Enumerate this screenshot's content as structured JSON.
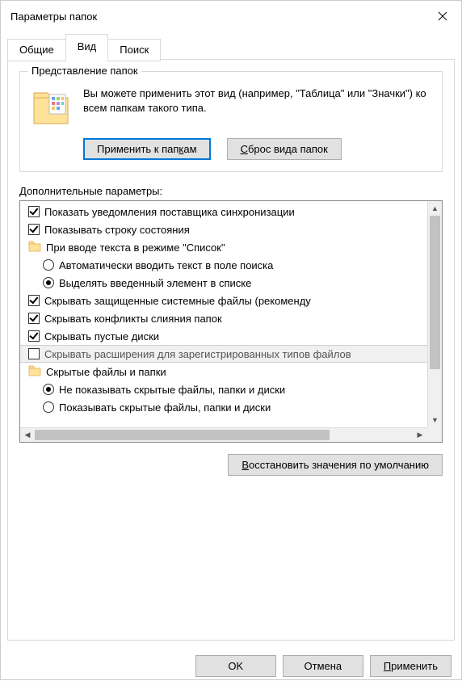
{
  "window": {
    "title": "Параметры папок"
  },
  "tabs": {
    "general": "Общие",
    "view": "Вид",
    "search": "Поиск"
  },
  "folderViews": {
    "legend": "Представление папок",
    "description": "Вы можете применить этот вид (например, \"Таблица\" или \"Значки\") ко всем папкам такого типа.",
    "applyBtn_pre": "Применить к пап",
    "applyBtn_u": "к",
    "applyBtn_post": "ам",
    "resetBtn_u": "С",
    "resetBtn_post": "брос вида папок"
  },
  "advanced": {
    "label": "Дополнительные параметры:",
    "items": [
      {
        "type": "checkbox",
        "checked": true,
        "indent": 0,
        "text": "Показать уведомления поставщика синхронизации"
      },
      {
        "type": "checkbox",
        "checked": true,
        "indent": 0,
        "text": "Показывать строку состояния"
      },
      {
        "type": "folder",
        "indent": 0,
        "text": "При вводе текста в режиме \"Список\""
      },
      {
        "type": "radio",
        "checked": false,
        "indent": 1,
        "text": "Автоматически вводить текст в поле поиска"
      },
      {
        "type": "radio",
        "checked": true,
        "indent": 1,
        "text": "Выделять введенный элемент в списке"
      },
      {
        "type": "checkbox",
        "checked": true,
        "indent": 0,
        "text": "Скрывать защищенные системные файлы (рекоменду"
      },
      {
        "type": "checkbox",
        "checked": true,
        "indent": 0,
        "text": "Скрывать конфликты слияния папок"
      },
      {
        "type": "checkbox",
        "checked": true,
        "indent": 0,
        "text": "Скрывать пустые диски"
      },
      {
        "type": "checkbox",
        "checked": false,
        "indent": 0,
        "highlighted": true,
        "text": "Скрывать расширения для зарегистрированных типов файлов"
      },
      {
        "type": "folder",
        "indent": 0,
        "text": "Скрытые файлы и папки"
      },
      {
        "type": "radio",
        "checked": true,
        "indent": 1,
        "text": "Не показывать скрытые файлы, папки и диски"
      },
      {
        "type": "radio",
        "checked": false,
        "indent": 1,
        "text": "Показывать скрытые файлы, папки и диски"
      }
    ]
  },
  "restoreDefaults_u": "В",
  "restoreDefaults_post": "осстановить значения по умолчанию",
  "footer": {
    "ok": "OK",
    "cancel": "Отмена",
    "apply_u": "П",
    "apply_post": "рименить"
  }
}
